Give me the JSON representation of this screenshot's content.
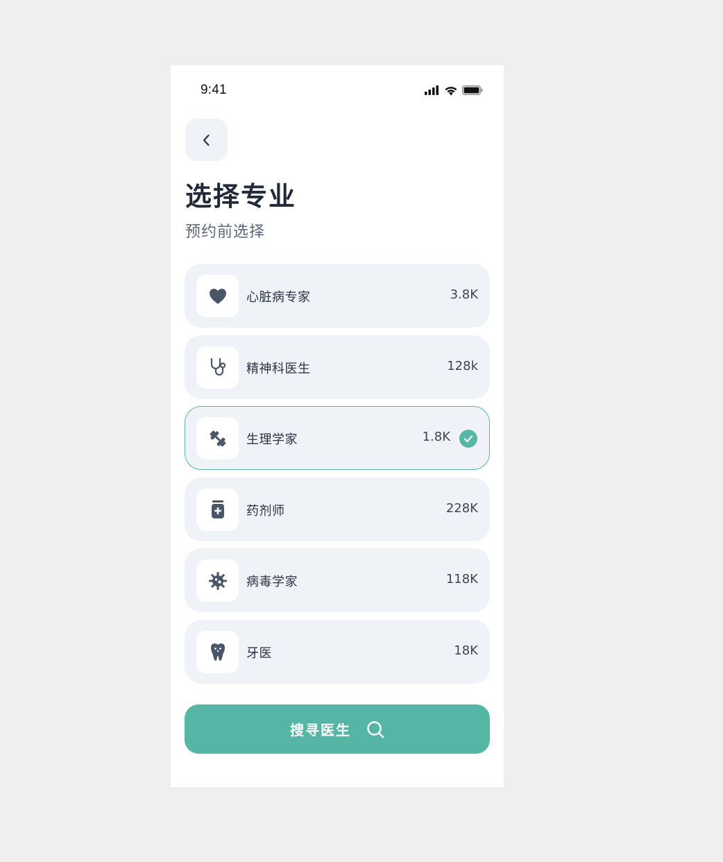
{
  "status_bar": {
    "time": "9:41"
  },
  "header": {
    "title": "选择专业",
    "subtitle": "预约前选择"
  },
  "specialties": [
    {
      "label": "心脏病专家",
      "count": "3.8K",
      "icon": "heart-icon",
      "selected": false
    },
    {
      "label": "精神科医生",
      "count": "128k",
      "icon": "stethoscope-icon",
      "selected": false
    },
    {
      "label": "生理学家",
      "count": "1.8K",
      "icon": "dumbbell-icon",
      "selected": true
    },
    {
      "label": "药剂师",
      "count": "228K",
      "icon": "pill-bottle-icon",
      "selected": false
    },
    {
      "label": "病毒学家",
      "count": "118K",
      "icon": "virus-icon",
      "selected": false
    },
    {
      "label": "牙医",
      "count": "18K",
      "icon": "tooth-icon",
      "selected": false
    }
  ],
  "search_button": {
    "label": "搜寻医生",
    "icon": "search-icon"
  },
  "colors": {
    "accent": "#56b6a6",
    "card_bg": "#eff3f8",
    "icon": "#4b5568",
    "title": "#222a3a"
  }
}
